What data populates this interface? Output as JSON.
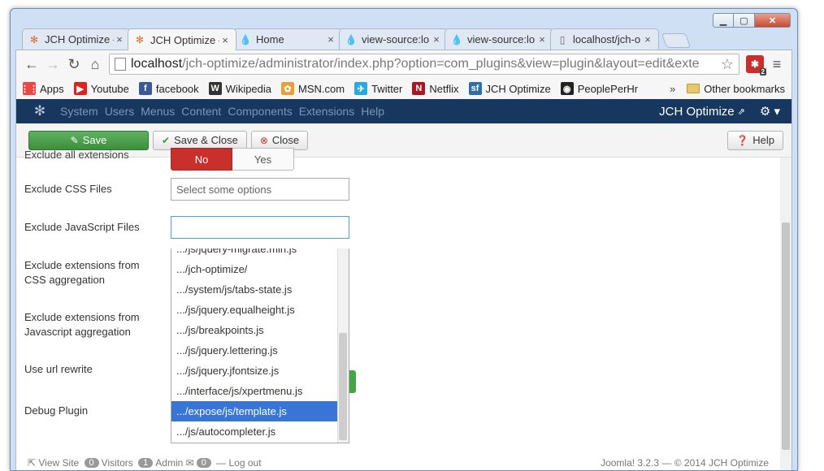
{
  "tabs": [
    {
      "title": "JCH Optimize -",
      "icon": "joomla-icon",
      "active": false
    },
    {
      "title": "JCH Optimize -",
      "icon": "joomla-icon",
      "active": true
    },
    {
      "title": "Home",
      "icon": "drop-icon",
      "active": false
    },
    {
      "title": "view-source:lo",
      "icon": "drop-icon",
      "active": false
    },
    {
      "title": "view-source:lo",
      "icon": "drop-icon",
      "active": false
    },
    {
      "title": "localhost/jch-o",
      "icon": "page-icon",
      "active": false
    }
  ],
  "address": {
    "host": "localhost",
    "path": "/jch-optimize/administrator/index.php?option=com_plugins&view=plugin&layout=edit&exte"
  },
  "extension_badge": "2",
  "bookmarks": [
    {
      "label": "Apps",
      "icon": "apps-icon",
      "color": "#e44"
    },
    {
      "label": "Youtube",
      "icon": "youtube-icon",
      "color": "#d22"
    },
    {
      "label": "facebook",
      "icon": "facebook-icon",
      "color": "#3b5998"
    },
    {
      "label": "Wikipedia",
      "icon": "wikipedia-icon",
      "color": "#333"
    },
    {
      "label": "MSN.com",
      "icon": "msn-icon",
      "color": "#e8a13a"
    },
    {
      "label": "Twitter",
      "icon": "twitter-icon",
      "color": "#2aa9e0"
    },
    {
      "label": "Netflix",
      "icon": "netflix-icon",
      "color": "#b0151d"
    },
    {
      "label": "JCH Optimize",
      "icon": "jch-icon",
      "color": "#2c6fb0"
    },
    {
      "label": "PeoplePerHr",
      "icon": "peopleperhr-icon",
      "color": "#222"
    }
  ],
  "bookmarks_more": "»",
  "other_bookmarks": "Other bookmarks",
  "joomla_menu": [
    "System",
    "Users",
    "Menus",
    "Content",
    "Components",
    "Extensions",
    "Help"
  ],
  "joomla_site_title": "JCH Optimize",
  "toolbar": {
    "save": "Save",
    "save_close": "Save & Close",
    "close": "Close",
    "help": "Help"
  },
  "form": {
    "exclude_all_label": "Exclude all extensions",
    "radio_no": "No",
    "radio_yes": "Yes",
    "exclude_css_label": "Exclude CSS Files",
    "exclude_css_placeholder": "Select some options",
    "exclude_js_label": "Exclude JavaScript Files",
    "exclude_ext_css_label": "Exclude extensions from CSS aggregation",
    "exclude_ext_js_label": "Exclude extensions from Javascript aggregation",
    "url_rewrite_label": "Use url rewrite",
    "debug_label": "Debug Plugin"
  },
  "dropdown_options": [
    ".../js/jquery-migrate.min.js",
    ".../jch-optimize/",
    ".../system/js/tabs-state.js",
    ".../js/jquery.equalheight.js",
    ".../js/breakpoints.js",
    ".../js/jquery.lettering.js",
    ".../js/jquery.jfontsize.js",
    ".../interface/js/xpertmenu.js",
    ".../expose/js/template.js",
    ".../js/autocompleter.js"
  ],
  "dropdown_highlighted_index": 8,
  "footer": {
    "view_site": "View Site",
    "visitors_count": "0",
    "visitors": "Visitors",
    "admin_count": "1",
    "admin": "Admin",
    "messages_count": "0",
    "logout": "Log out",
    "version": "Joomla! 3.2.3 — © 2014 JCH Optimize"
  }
}
